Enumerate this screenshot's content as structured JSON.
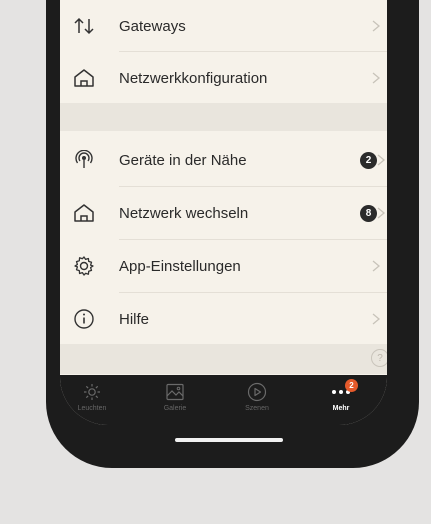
{
  "menu": {
    "gateways": "Gateways",
    "network_config": "Netzwerkkonfiguration",
    "nearby_devices": "Geräte in der Nähe",
    "nearby_count": "2",
    "switch_network": "Netzwerk wechseln",
    "switch_count": "8",
    "app_settings": "App-Einstellungen",
    "help": "Hilfe"
  },
  "help_fab": "?",
  "tabbar": {
    "tabs": [
      {
        "label": "Leuchten",
        "icon": "sun-icon"
      },
      {
        "label": "Galerie",
        "icon": "gallery-icon"
      },
      {
        "label": "Szenen",
        "icon": "play-circle-icon"
      },
      {
        "label": "Mehr",
        "icon": "more-dots-icon",
        "badge": "2"
      }
    ],
    "active": "Mehr"
  },
  "colors": {
    "background": "#e4e3e2",
    "screen": "#f6f2ea",
    "tabbar": "#1c1c1c",
    "badge": "#e55a2b"
  }
}
